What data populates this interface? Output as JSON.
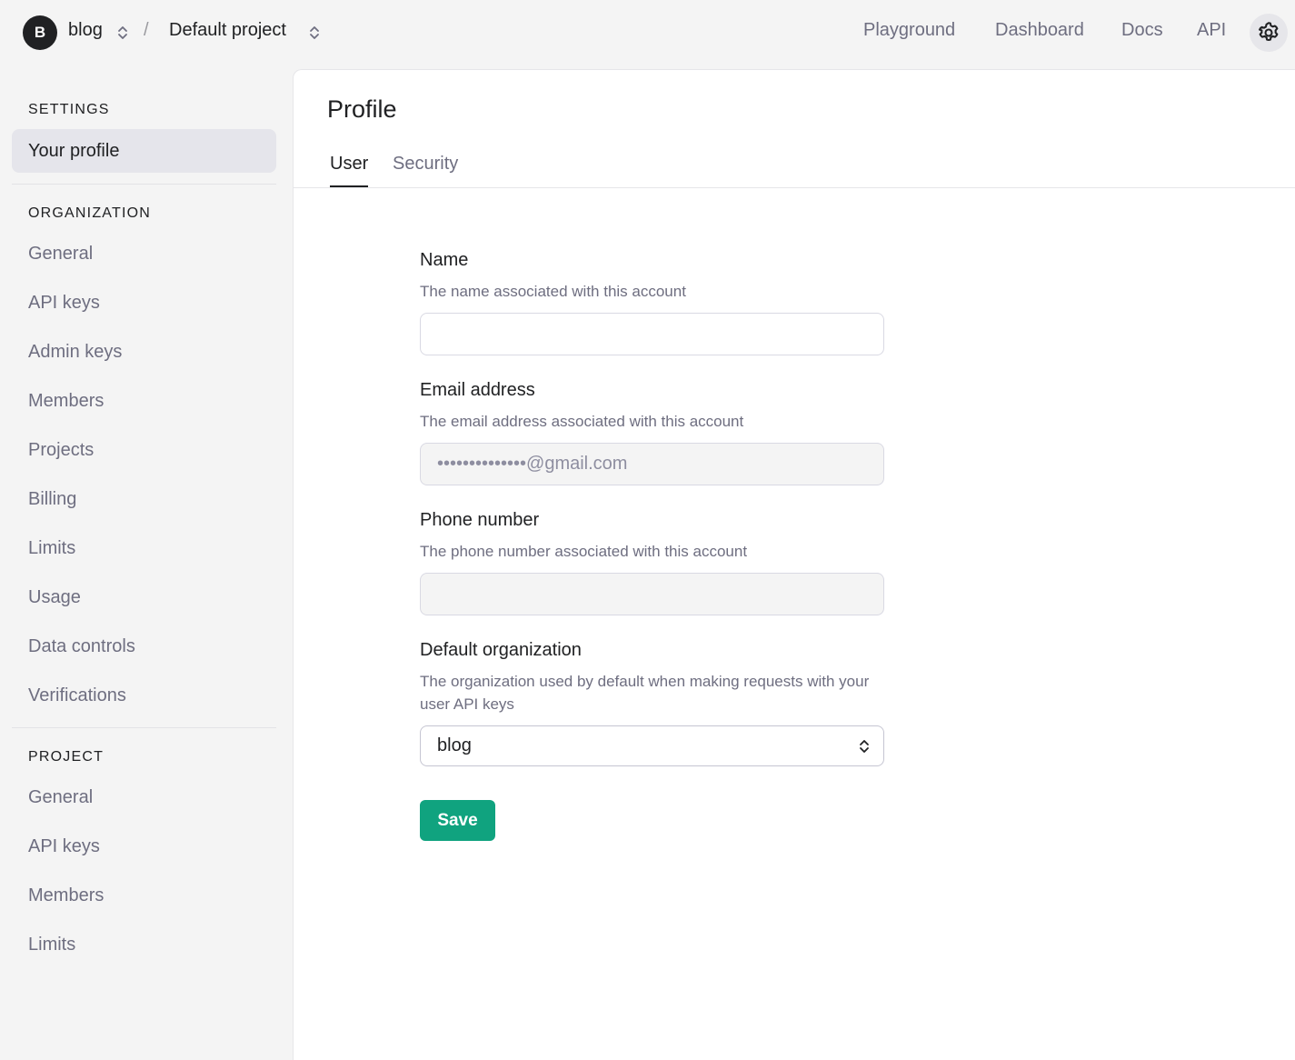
{
  "topbar": {
    "org_avatar_letter": "B",
    "org_name": "blog",
    "separator": "/",
    "project_name": "Default project",
    "nav": [
      "Playground",
      "Dashboard",
      "Docs",
      "API"
    ],
    "settings_icon": "gear-icon"
  },
  "sidebar": {
    "settings_heading": "SETTINGS",
    "settings_items": [
      "Your profile"
    ],
    "organization_heading": "ORGANIZATION",
    "organization_items": [
      "General",
      "API keys",
      "Admin keys",
      "Members",
      "Projects",
      "Billing",
      "Limits",
      "Usage",
      "Data controls",
      "Verifications"
    ],
    "project_heading": "PROJECT",
    "project_items": [
      "General",
      "API keys",
      "Members",
      "Limits"
    ]
  },
  "main": {
    "title": "Profile",
    "tabs": [
      "User",
      "Security"
    ],
    "active_tab": "User",
    "form": {
      "name_label": "Name",
      "name_help": "The name associated with this account",
      "name_value": "",
      "email_label": "Email address",
      "email_help": "The email address associated with this account",
      "email_value": "••••••••••••••@gmail.com",
      "phone_label": "Phone number",
      "phone_help": "The phone number associated with this account",
      "phone_value": "",
      "default_org_label": "Default organization",
      "default_org_help": "The organization used by default when making requests with your user API keys",
      "default_org_value": "blog",
      "save_label": "Save"
    }
  },
  "colors": {
    "accent": "#10a37f",
    "sidebar_bg": "#f4f4f4",
    "active_item_bg": "#e5e5eb"
  }
}
